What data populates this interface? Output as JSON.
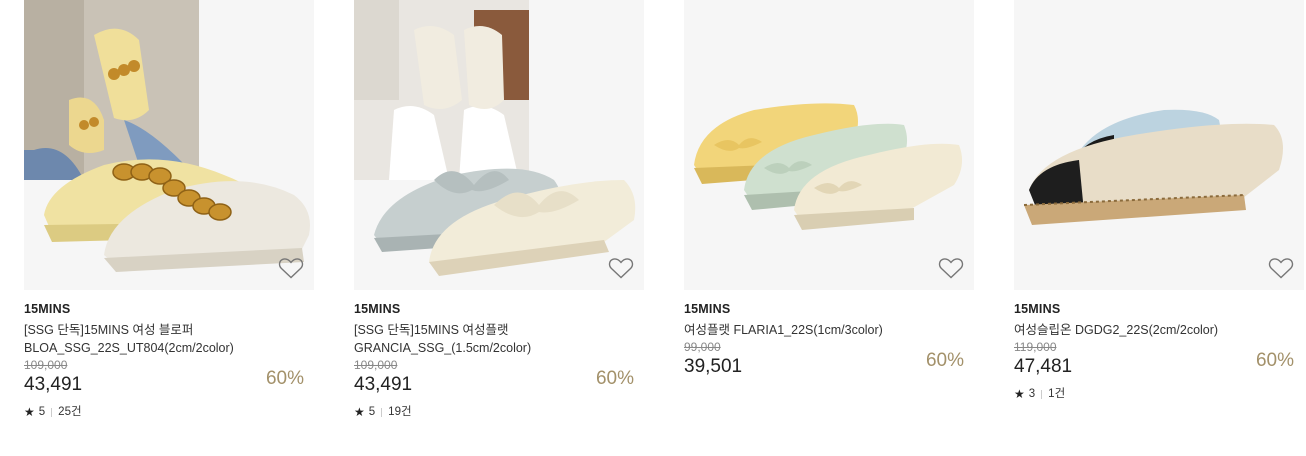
{
  "products": [
    {
      "brand": "15MINS",
      "name_line1": "[SSG 단독]15MINS 여성 블로퍼",
      "name_line2": "BLOA_SSG_22S_UT804(2cm/2color)",
      "original_price": "109,000",
      "price": "43,491",
      "discount": "60%",
      "rating": "5",
      "reviews": "25건",
      "image": "yellow-chain-mule"
    },
    {
      "brand": "15MINS",
      "name_line1": "[SSG 단독]15MINS 여성플랫",
      "name_line2": "GRANCIA_SSG_(1.5cm/2color)",
      "original_price": "109,000",
      "price": "43,491",
      "discount": "60%",
      "rating": "5",
      "reviews": "19건",
      "image": "bow-flat"
    },
    {
      "brand": "15MINS",
      "name_line1": "여성플랫 FLARIA1_22S(1cm/3color)",
      "name_line2": "",
      "original_price": "99,000",
      "price": "39,501",
      "discount": "60%",
      "image": "ballet-flats"
    },
    {
      "brand": "15MINS",
      "name_line1": "여성슬립온 DGDG2_22S(2cm/2color)",
      "name_line2": "",
      "original_price": "119,000",
      "price": "47,481",
      "discount": "60%",
      "rating": "3",
      "reviews": "1건",
      "image": "espadrille"
    }
  ],
  "icons": {
    "wishlist": "heart-outline-icon",
    "rating": "star-icon"
  },
  "colors": {
    "discount": "#a3916a",
    "background": "#f5f5f5"
  }
}
